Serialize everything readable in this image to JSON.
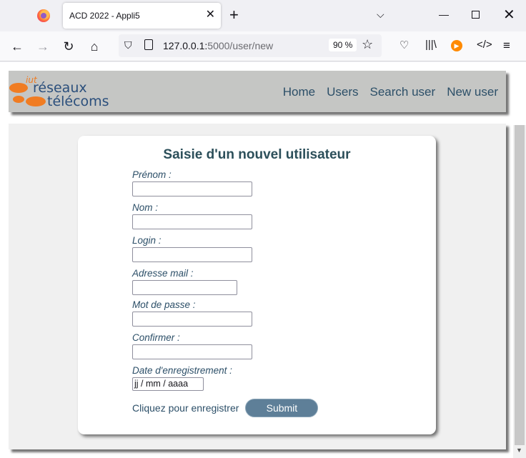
{
  "browser": {
    "tab_title": "ACD 2022 - Appli5",
    "url_host": "127.0.0.1:",
    "url_path": "5000/user/new",
    "zoom": "90 %"
  },
  "site": {
    "logo_text_top": "iut",
    "logo_text_1": "réseaux",
    "logo_text_2": "télécoms",
    "nav": [
      "Home",
      "Users",
      "Search user",
      "New user"
    ]
  },
  "form": {
    "title": "Saisie d'un nouvel utilisateur",
    "fields": [
      {
        "label": "Prénom :",
        "value": ""
      },
      {
        "label": "Nom :",
        "value": ""
      },
      {
        "label": "Login :",
        "value": ""
      },
      {
        "label": "Adresse mail :",
        "value": ""
      },
      {
        "label": "Mot de passe :",
        "value": ""
      },
      {
        "label": "Confirmer :",
        "value": ""
      },
      {
        "label": "Date d'enregistrement :",
        "placeholder": "jj / mm / aaaa"
      }
    ],
    "submit_text": "Cliquez pour enregistrer",
    "submit_label": "Submit"
  }
}
